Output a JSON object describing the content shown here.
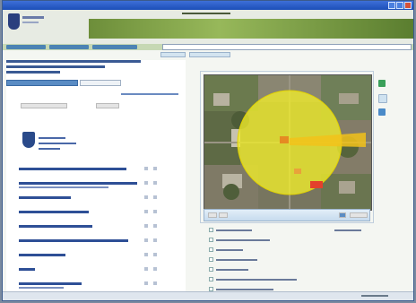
{
  "window": {
    "title": "",
    "buttons": [
      "minimize",
      "maximize",
      "close"
    ]
  },
  "icons": {
    "logo": "city-seal-logo",
    "seal": "government-seal-icon",
    "zoom_in": "zoom-in-icon",
    "zoom_out": "zoom-out-icon",
    "info": "info-icon"
  },
  "colors": {
    "title_bar": "#1c4fb8",
    "banner": "#97b85a",
    "link": "#2e4f96",
    "buffer_circle": "#f2ee2a",
    "map_marker": "#e3402c"
  },
  "list_rows": 10,
  "layers": 8
}
